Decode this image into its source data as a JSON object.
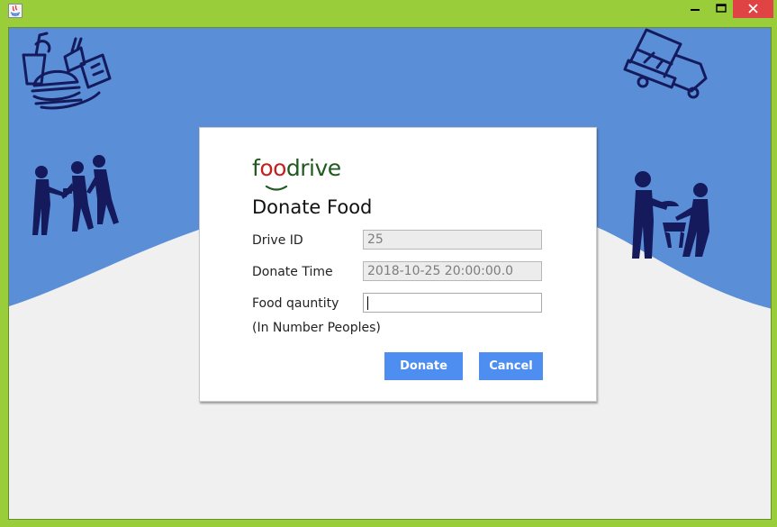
{
  "window": {
    "icons": {
      "app": "java-app-icon",
      "minimize": "minimize-icon",
      "maximize": "maximize-icon",
      "close": "close-icon"
    }
  },
  "background": {
    "illustrations": [
      "fast-food-icon",
      "food-truck-icon",
      "people-sharing-food-icon",
      "people-serving-food-icon"
    ]
  },
  "dialog": {
    "logo": {
      "pre": "f",
      "oo": "oo",
      "post": "drive"
    },
    "title": "Donate Food",
    "fields": {
      "drive_id": {
        "label": "Drive ID",
        "value": "25"
      },
      "donate_time": {
        "label": "Donate Time",
        "value": "2018-10-25 20:00:00.0"
      },
      "food_quantity": {
        "label": "Food qauntity",
        "value": "",
        "note": "(In Number Peoples)"
      }
    },
    "buttons": {
      "donate": "Donate",
      "cancel": "Cancel"
    }
  },
  "colors": {
    "window_frame": "#9acd3a",
    "header_blue": "#5a8fd8",
    "illustration": "#141a5c",
    "button": "#4d8ef0",
    "logo_green": "#1f5a1f",
    "logo_red": "#c42020"
  }
}
